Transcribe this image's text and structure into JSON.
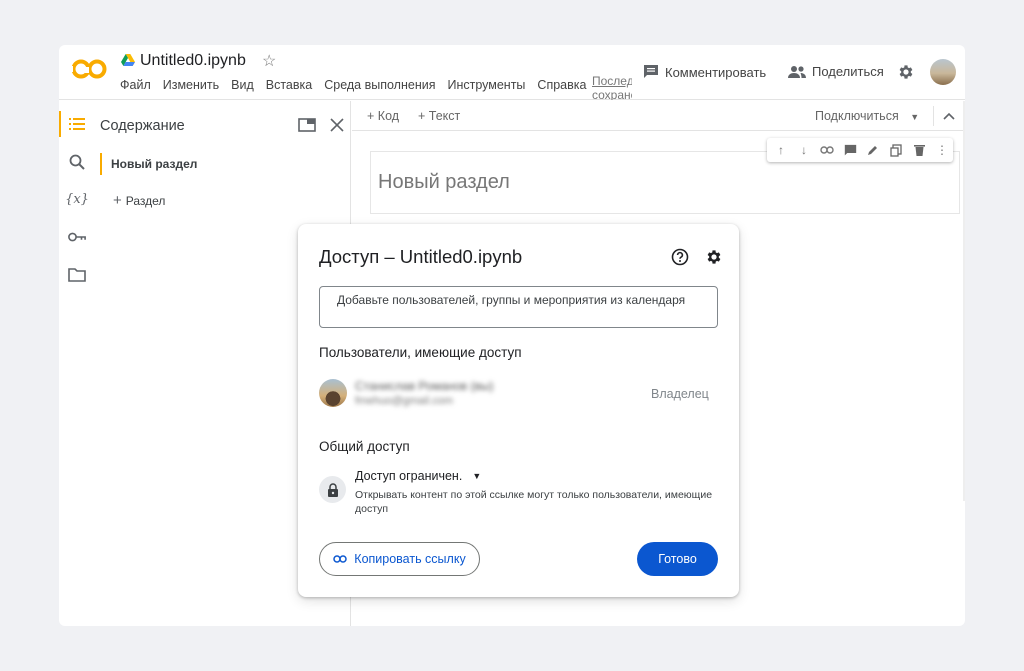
{
  "header": {
    "logo": "CO",
    "doc_title": "Untitled0.ipynb",
    "menu": [
      "Файл",
      "Изменить",
      "Вид",
      "Вставка",
      "Среда выполнения",
      "Инструменты",
      "Справка"
    ],
    "last_saved": "Последнее сохранение",
    "comment_label": "Комментировать",
    "share_label": "Поделиться",
    "icons": [
      "drive-icon",
      "star-icon",
      "comment-icon",
      "people-icon",
      "gear-icon",
      "avatar"
    ]
  },
  "toc": {
    "title": "Содержание",
    "items": [
      "Новый раздел"
    ],
    "add_section": "Раздел"
  },
  "rail": {
    "icons": [
      "toc-icon",
      "search-icon",
      "variables-icon",
      "key-icon",
      "folder-icon"
    ],
    "variables_glyph": "{x}"
  },
  "toolbar": {
    "add_code": "Код",
    "add_text": "Текст",
    "connect": "Подключиться"
  },
  "cell": {
    "heading": "Новый раздел"
  },
  "dialog": {
    "title": "Доступ – Untitled0.ipynb",
    "input_placeholder": "Добавьте пользователей, группы и мероприятия из календаря",
    "people_section": "Пользователи, имеющие доступ",
    "user_name": "Станислав Романов (вы)",
    "user_email": "fmehuo@gmail.com",
    "user_role": "Владелец",
    "general_section": "Общий доступ",
    "access_type": "Доступ ограничен.",
    "access_desc": "Открывать контент по этой ссылке могут только пользователи, имеющие доступ",
    "copy_link": "Копировать ссылку",
    "done": "Готово"
  },
  "colors": {
    "accent_orange": "#f9ab00",
    "primary_blue": "#0b57d0",
    "page_bg": "#f0f1f4"
  }
}
